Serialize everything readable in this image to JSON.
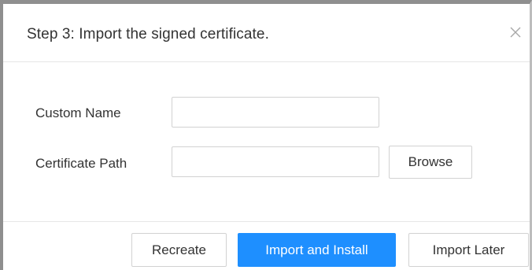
{
  "dialog": {
    "title": "Step 3: Import the signed certificate.",
    "close_icon": "close-icon"
  },
  "form": {
    "custom_name": {
      "label": "Custom Name",
      "value": "",
      "placeholder": ""
    },
    "certificate_path": {
      "label": "Certificate Path",
      "value": "",
      "placeholder": ""
    },
    "browse_label": "Browse"
  },
  "footer": {
    "recreate_label": "Recreate",
    "import_install_label": "Import and Install",
    "import_later_label": "Import Later"
  },
  "colors": {
    "primary": "#1e8fff",
    "border": "#d2d2d2",
    "text": "#333333",
    "frame": "#8f8f8f"
  }
}
